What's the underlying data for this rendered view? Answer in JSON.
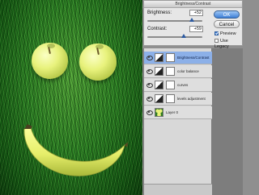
{
  "dialog": {
    "title": "Brightness/Contrast",
    "brightness_label": "Brightness:",
    "brightness_value": "+52",
    "contrast_label": "Contrast:",
    "contrast_value": "+59",
    "ok_label": "OK",
    "cancel_label": "Cancel",
    "preview_label": "Preview",
    "preview_checked": true,
    "legacy_label": "Use Legacy",
    "legacy_checked": false
  },
  "layers": [
    {
      "label": "Brightness/Contrast",
      "type": "adjustment",
      "selected": true
    },
    {
      "label": "color balance",
      "type": "adjustment",
      "selected": false
    },
    {
      "label": "curves",
      "type": "adjustment",
      "selected": false
    },
    {
      "label": "levels adjustment",
      "type": "adjustment",
      "selected": false
    },
    {
      "label": "Layer 0",
      "type": "photo",
      "selected": false
    }
  ],
  "colors": {
    "accent": "#3d7fd6",
    "selected_layer": "#8cb0e8",
    "grass": "#2f8726",
    "fruit": "#e8f27c"
  }
}
